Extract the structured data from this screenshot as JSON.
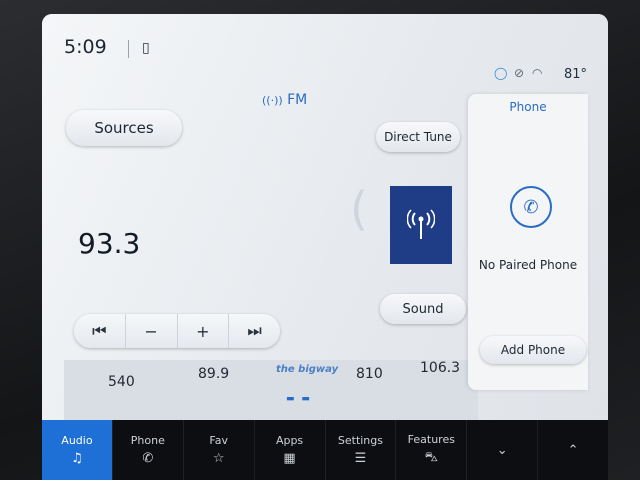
{
  "status": {
    "time": "5:09",
    "temperature": "81°"
  },
  "radio": {
    "band": "FM",
    "frequency": "93.3",
    "sources_label": "Sources",
    "direct_tune_label": "Direct Tune",
    "sound_label": "Sound",
    "presets": [
      "540",
      "89.9",
      "the bigway",
      "810",
      "106.3"
    ]
  },
  "phone_panel": {
    "title": "Phone",
    "status_text": "No Paired Phone",
    "add_phone_label": "Add Phone"
  },
  "dock": [
    {
      "label": "Audio",
      "icon": "music-note-icon",
      "active": true
    },
    {
      "label": "Phone",
      "icon": "phone-icon"
    },
    {
      "label": "Fav",
      "icon": "star-icon"
    },
    {
      "label": "Apps",
      "icon": "grid-icon"
    },
    {
      "label": "Settings",
      "icon": "sliders-icon"
    },
    {
      "label": "Features",
      "icon": "car-icon"
    },
    {
      "label": "",
      "icon": "chevron-down-icon"
    },
    {
      "label": "",
      "icon": "chevron-up-icon"
    }
  ]
}
